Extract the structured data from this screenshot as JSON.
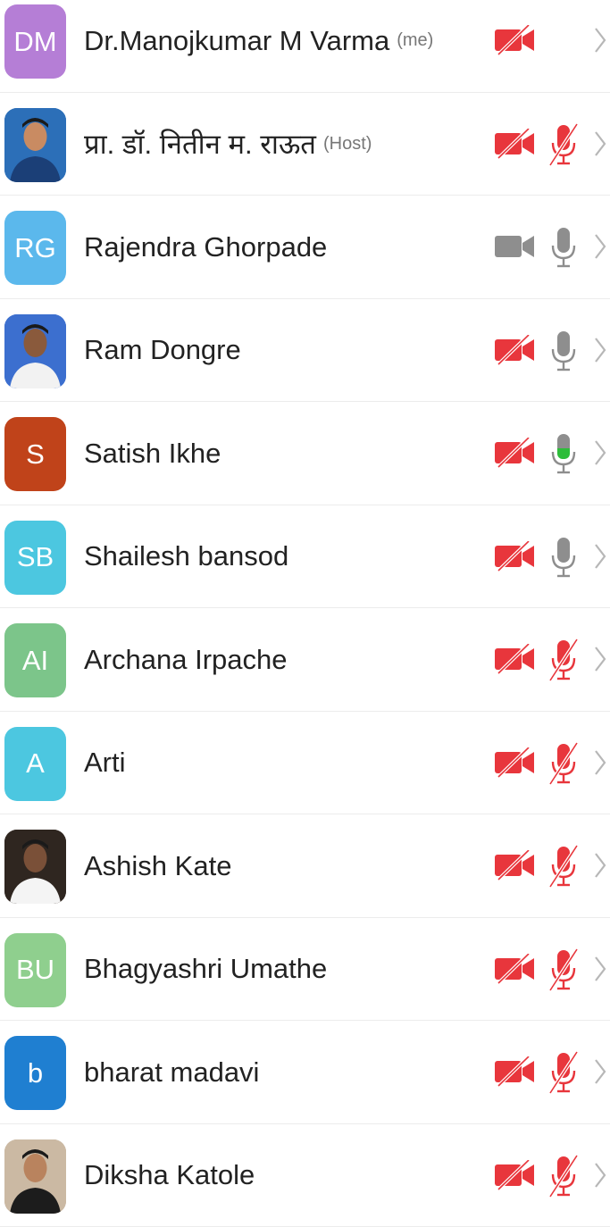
{
  "participants": [
    {
      "name": "Dr.Manojkumar M Varma",
      "role": "(me)",
      "initials": "DM",
      "avatar_type": "initials",
      "avatar_color": "#b57ed6",
      "video": "off",
      "audio": "none"
    },
    {
      "name": "प्रा. डॉ. नितीन म. राऊत",
      "role": "(Host)",
      "initials": "",
      "avatar_type": "photo",
      "avatar_color": "#2a6fb5",
      "video": "off",
      "audio": "muted"
    },
    {
      "name": "Rajendra Ghorpade",
      "role": "",
      "initials": "RG",
      "avatar_type": "initials",
      "avatar_color": "#5bb8ec",
      "video": "on",
      "audio": "on"
    },
    {
      "name": "Ram Dongre",
      "role": "",
      "initials": "",
      "avatar_type": "photo",
      "avatar_color": "#3a6fd0",
      "video": "off",
      "audio": "on"
    },
    {
      "name": "Satish Ikhe",
      "role": "",
      "initials": "S",
      "avatar_type": "initials",
      "avatar_color": "#c0431a",
      "video": "off",
      "audio": "speaking"
    },
    {
      "name": "Shailesh bansod",
      "role": "",
      "initials": "SB",
      "avatar_type": "initials",
      "avatar_color": "#4cc7e0",
      "video": "off",
      "audio": "on"
    },
    {
      "name": "Archana Irpache",
      "role": "",
      "initials": "AI",
      "avatar_type": "initials",
      "avatar_color": "#7cc58a",
      "video": "off",
      "audio": "muted"
    },
    {
      "name": "Arti",
      "role": "",
      "initials": "A",
      "avatar_type": "initials",
      "avatar_color": "#4cc7e0",
      "video": "off",
      "audio": "muted"
    },
    {
      "name": "Ashish Kate",
      "role": "",
      "initials": "",
      "avatar_type": "photo",
      "avatar_color": "#3b2f2a",
      "video": "off",
      "audio": "muted"
    },
    {
      "name": "Bhagyashri Umathe",
      "role": "",
      "initials": "BU",
      "avatar_type": "initials",
      "avatar_color": "#8fcf8e",
      "video": "off",
      "audio": "muted"
    },
    {
      "name": "bharat madavi",
      "role": "",
      "initials": "b",
      "avatar_type": "initials",
      "avatar_color": "#1f7fd1",
      "video": "off",
      "audio": "muted"
    },
    {
      "name": "Diksha Katole",
      "role": "",
      "initials": "",
      "avatar_type": "photo",
      "avatar_color": "#b9a38c",
      "video": "off",
      "audio": "muted"
    }
  ],
  "icons": {
    "camera_off": "video-off-icon",
    "camera_on": "video-on-icon",
    "mic_muted": "microphone-muted-icon",
    "mic_on": "microphone-icon",
    "chevron": "chevron-right-icon"
  },
  "colors": {
    "muted_red": "#e8363c",
    "icon_gray": "#8e8e8e",
    "speaking_green": "#2dbd3a",
    "chevron": "#b7b7b7"
  }
}
